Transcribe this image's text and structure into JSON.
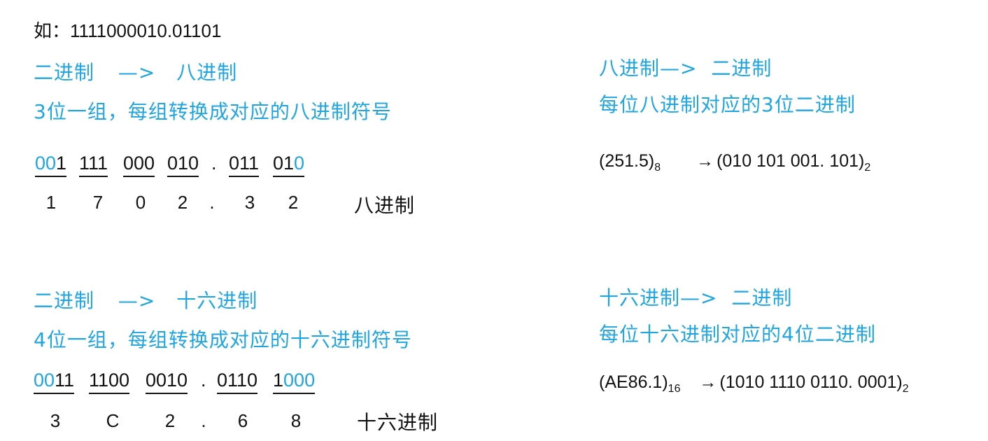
{
  "intro": {
    "label": "如：",
    "value": "1111000010.01101"
  },
  "bin_to_oct": {
    "title_left": "二进制",
    "title_arrow": "—>",
    "title_right": "八进制",
    "rule": "3位一组，每组转换成对应的八进制符号",
    "groups": [
      {
        "blue": "00",
        "black": "1",
        "tail": ""
      },
      {
        "blue": "",
        "black": "111",
        "tail": ""
      },
      {
        "blue": "",
        "black": "000",
        "tail": ""
      },
      {
        "blue": "",
        "black": "010",
        "tail": ""
      },
      {
        "blue": "",
        "black": "011",
        "tail": ""
      },
      {
        "blue": "",
        "black": "01",
        "tail": "0"
      }
    ],
    "point": ".",
    "digits": [
      "1",
      "7",
      "0",
      "2",
      ".",
      "3",
      "2"
    ],
    "result_label": "八进制"
  },
  "oct_to_bin": {
    "title_left": "八进制",
    "title_arrow": "—>",
    "title_right": "二进制",
    "rule": "每位八进制对应的3位二进制",
    "from_value": "(251.5)",
    "from_base": "8",
    "arrow": "→",
    "to_value": "(010 101 001. 101)",
    "to_base": "2"
  },
  "bin_to_hex": {
    "title_left": "二进制",
    "title_arrow": "—>",
    "title_right": "十六进制",
    "rule": "4位一组，每组转换成对应的十六进制符号",
    "groups": [
      {
        "blue": "00",
        "black": "11",
        "tail": ""
      },
      {
        "blue": "",
        "black": "1100",
        "tail": ""
      },
      {
        "blue": "",
        "black": "0010",
        "tail": ""
      },
      {
        "blue": "",
        "black": "0110",
        "tail": ""
      },
      {
        "blue": "",
        "black": "1",
        "tail": "000"
      }
    ],
    "point": ".",
    "digits": [
      "3",
      "C",
      "2",
      ".",
      "6",
      "8"
    ],
    "result_label": "十六进制"
  },
  "hex_to_bin": {
    "title_left": "十六进制",
    "title_arrow": "—>",
    "title_right": "二进制",
    "rule": "每位十六进制对应的4位二进制",
    "from_value": "(AE86.1)",
    "from_base": "16",
    "arrow": "→",
    "to_value": "(1010 1110 0110. 0001)",
    "to_base": "2"
  },
  "colors": {
    "accent": "#1fa5e0",
    "text": "#111111"
  }
}
